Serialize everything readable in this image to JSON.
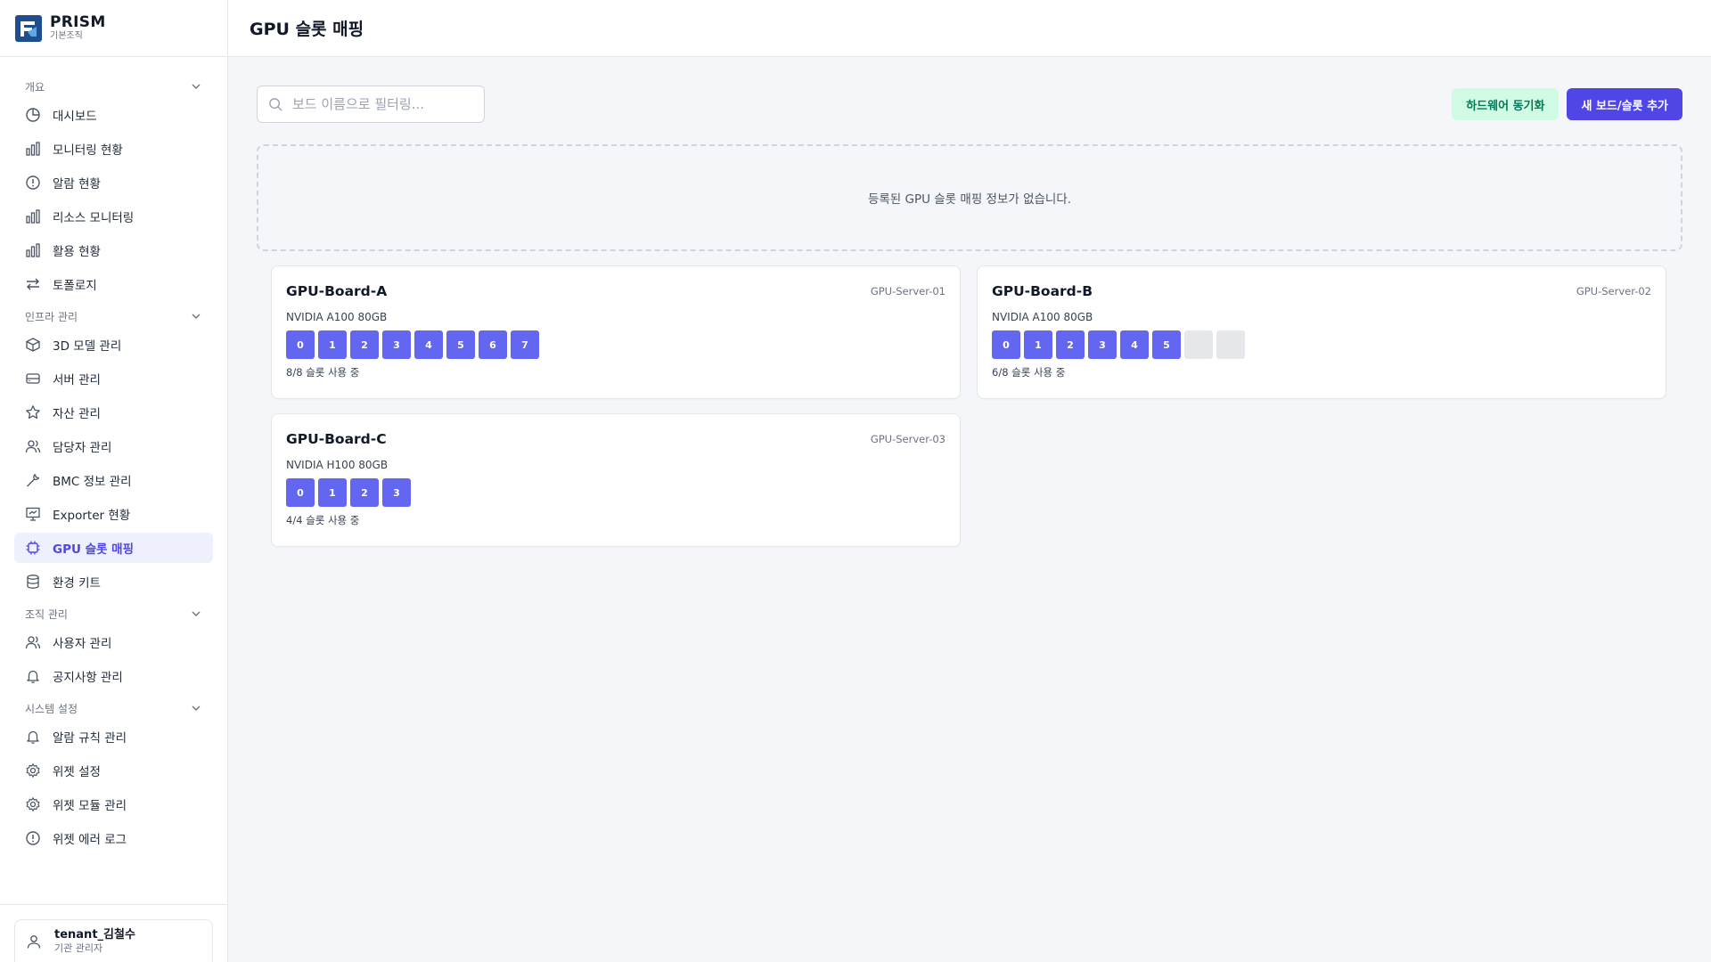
{
  "brand": {
    "name": "PRISM",
    "subtitle": "기본조직"
  },
  "page_title": "GPU 슬롯 매핑",
  "nav": {
    "overview": {
      "title": "개요",
      "items": [
        "대시보드",
        "모니터링 현황",
        "알람 현황",
        "리소스 모니터링",
        "활용 현황",
        "토폴로지"
      ]
    },
    "infra": {
      "title": "인프라 관리",
      "items": [
        "3D 모델 관리",
        "서버 관리",
        "자산 관리",
        "담당자 관리",
        "BMC 정보 관리",
        "Exporter 현황",
        "GPU 슬롯 매핑",
        "환경 키트"
      ]
    },
    "org": {
      "title": "조직 관리",
      "items": [
        "사용자 관리",
        "공지사항 관리"
      ]
    },
    "system": {
      "title": "시스템 설정",
      "items": [
        "알람 규칙 관리",
        "위젯 설정",
        "위젯 모듈 관리",
        "위젯 에러 로그"
      ]
    }
  },
  "user": {
    "name": "tenant_김철수",
    "role": "기관 관리자"
  },
  "search": {
    "placeholder": "보드 이름으로 필터링..."
  },
  "actions": {
    "sync_label": "하드웨어 동기화",
    "add_label": "새 보드/슬롯 추가"
  },
  "empty_message": "등록된 GPU 슬롯 매핑 정보가 없습니다.",
  "boards": [
    {
      "name": "GPU-Board-A",
      "server": "GPU-Server-01",
      "model": "NVIDIA A100 80GB",
      "slots": [
        "0",
        "1",
        "2",
        "3",
        "4",
        "5",
        "6",
        "7"
      ],
      "free_slots": 0,
      "usage": "8/8 슬롯 사용 중"
    },
    {
      "name": "GPU-Board-B",
      "server": "GPU-Server-02",
      "model": "NVIDIA A100 80GB",
      "slots": [
        "0",
        "1",
        "2",
        "3",
        "4",
        "5"
      ],
      "free_slots": 2,
      "usage": "6/8 슬롯 사용 중"
    },
    {
      "name": "GPU-Board-C",
      "server": "GPU-Server-03",
      "model": "NVIDIA H100 80GB",
      "slots": [
        "0",
        "1",
        "2",
        "3"
      ],
      "free_slots": 0,
      "usage": "4/4 슬롯 사용 중"
    }
  ],
  "colors": {
    "accent": "#4f46e5",
    "slot_used": "#6366f1",
    "slot_free": "#e5e7eb",
    "sync_bg": "#d1fae5",
    "sync_text": "#047857",
    "active_bg": "#eef0fd"
  }
}
